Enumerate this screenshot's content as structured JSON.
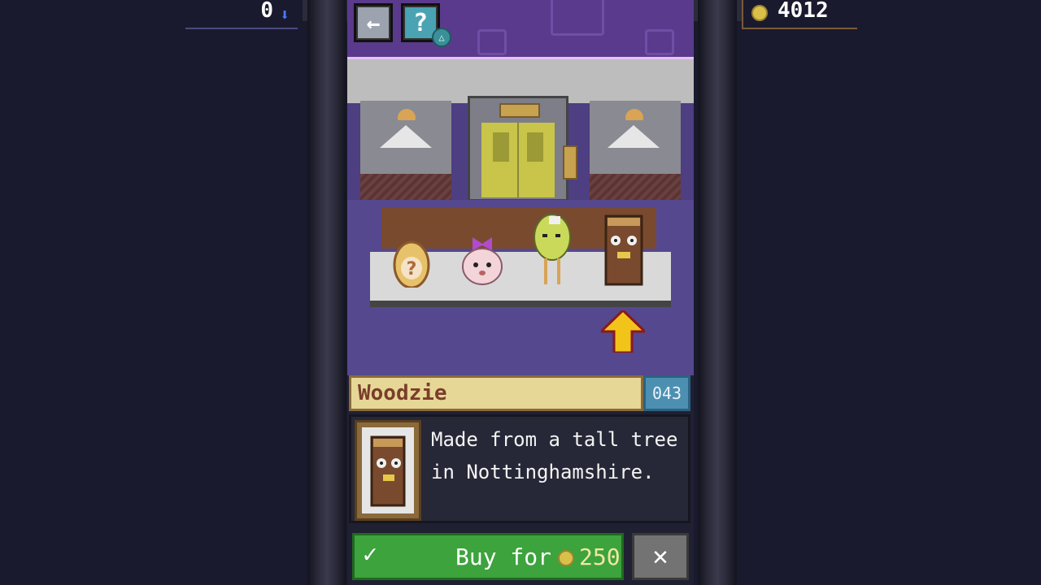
{
  "hud": {
    "gem_count": "0",
    "gem_icon": "blue-arrow-down",
    "coin_count": "4012",
    "coin_icon": "gold-coin"
  },
  "toolbar": {
    "back_label": "←",
    "help_label": "?",
    "triangle_label": "△"
  },
  "item": {
    "name": "Woodzie",
    "number": "043",
    "description": "Made from a tall tree in Nottinghamshire."
  },
  "actions": {
    "buy_check": "✓",
    "buy_label": "Buy for",
    "buy_price": "250",
    "close_label": "✕"
  },
  "colors": {
    "buy_button": "#3da33d",
    "name_bar": "#e6d797",
    "number_badge": "#4c8fb1",
    "coin": "#d9c049"
  }
}
